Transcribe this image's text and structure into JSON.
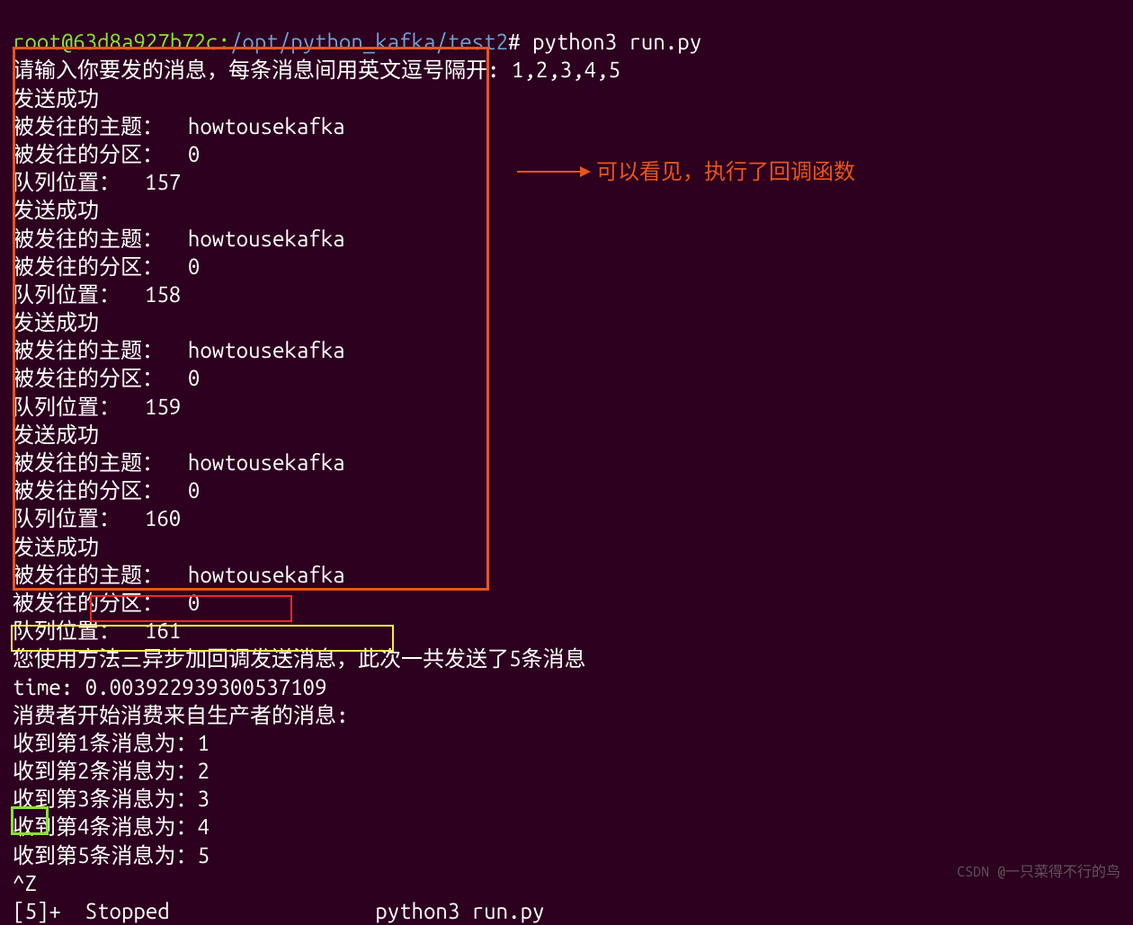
{
  "prompt": {
    "user": "root@63d8a927b72c",
    "sep": ":",
    "path": "/opt/python_kafka/test2",
    "symbol": "#",
    "command": "python3 run.py"
  },
  "lines": {
    "input_prompt": "请输入你要发的消息，每条消息间用英文逗号隔开: 1,2,3,4,5",
    "send_success": "发送成功",
    "topic_label": "被发往的主题：  howtousekafka",
    "partition_label": "被发往的分区：  0",
    "q157": "队列位置：  157",
    "q158": "队列位置：  158",
    "q159": "队列位置：  159",
    "q160": "队列位置：  160",
    "q161": "队列位置：  161",
    "summary": "您使用方法三异步加回调发送消息，此次一共发送了5条消息",
    "time": "time: 0.003922939300537109",
    "consumer_start": "消费者开始消费来自生产者的消息:",
    "msg1": "收到第1条消息为：1",
    "msg2": "收到第2条消息为：2",
    "msg3": "收到第3条消息为：3",
    "msg4": "收到第4条消息为：4",
    "msg5": "收到第5条消息为：5",
    "ctrl_z": "^Z",
    "stopped": "[5]+  Stopped                 python3 run.py"
  },
  "annotation": {
    "callback_note": "可以看见，执行了回调函数"
  },
  "watermark": "CSDN @一只菜得不行的鸟"
}
